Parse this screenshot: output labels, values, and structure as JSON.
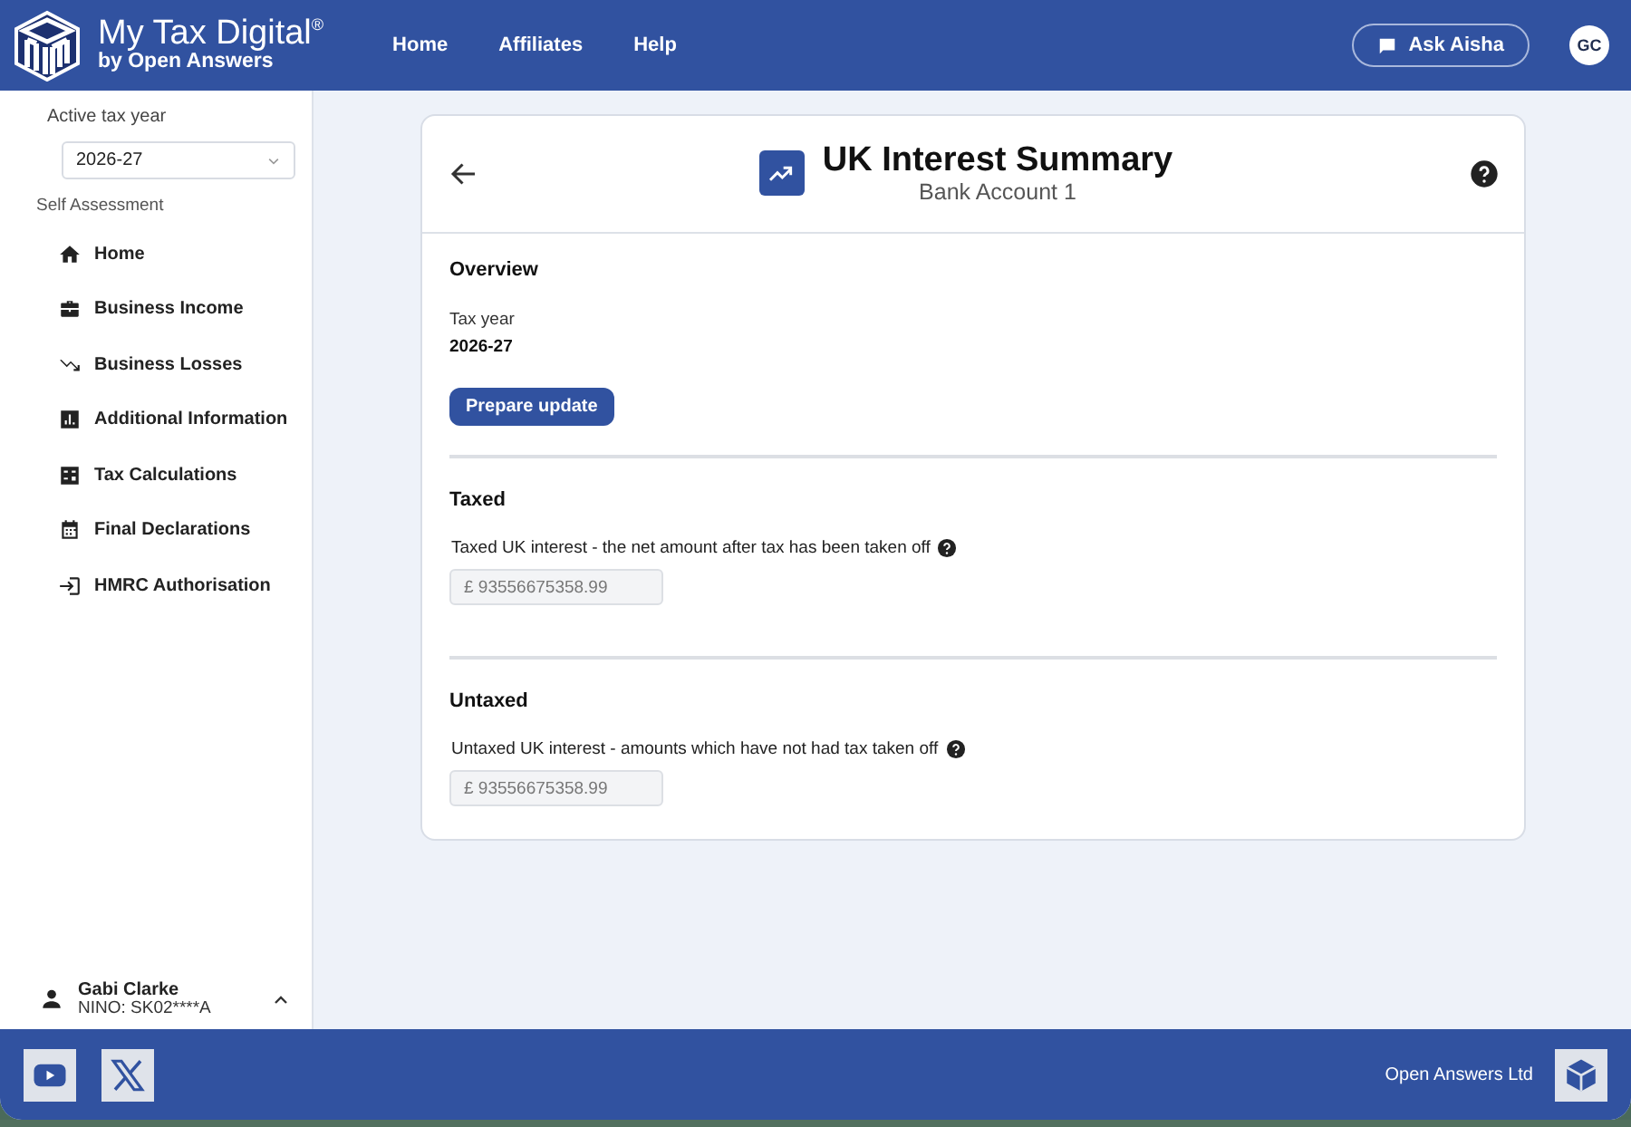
{
  "header": {
    "brand": "My Tax Digital",
    "brand_mark": "®",
    "tagline": "by Open Answers",
    "nav": [
      "Home",
      "Affiliates",
      "Help"
    ],
    "ask_button": "Ask Aisha",
    "avatar": "GC"
  },
  "sidebar": {
    "tax_year_label": "Active tax year",
    "tax_year": "2026-27",
    "section": "Self Assessment",
    "items": [
      {
        "label": "Home"
      },
      {
        "label": "Business Income"
      },
      {
        "label": "Business Losses"
      },
      {
        "label": "Additional Information"
      },
      {
        "label": "Tax Calculations"
      },
      {
        "label": "Final Declarations"
      },
      {
        "label": "HMRC Authorisation"
      }
    ],
    "user": {
      "name": "Gabi Clarke",
      "nino": "NINO: SK02****A"
    }
  },
  "card": {
    "title": "UK Interest Summary",
    "subtitle": "Bank Account 1",
    "overview": {
      "heading": "Overview",
      "label": "Tax year",
      "value": "2026-27",
      "button": "Prepare update"
    },
    "sections": [
      {
        "heading": "Taxed",
        "label": "Taxed UK interest - the net amount after tax has been taken off",
        "placeholder": "£ 93556675358.99"
      },
      {
        "heading": "Untaxed",
        "label": "Untaxed UK interest - amounts which have not had tax taken off",
        "placeholder": "£ 93556675358.99"
      }
    ]
  },
  "footer": {
    "company": "Open Answers Ltd"
  }
}
